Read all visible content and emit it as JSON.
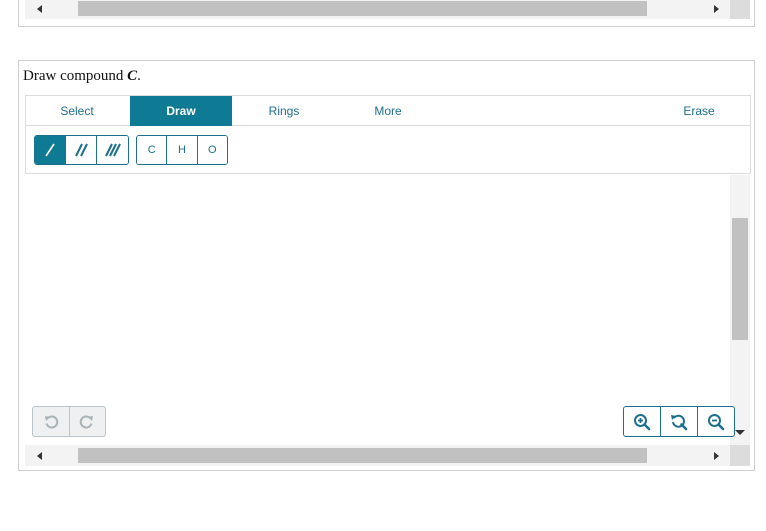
{
  "prompt": {
    "text_before": "Draw compound ",
    "compound": "C",
    "text_after": "."
  },
  "tabs": [
    {
      "label": "Select",
      "active": false
    },
    {
      "label": "Draw",
      "active": true
    },
    {
      "label": "Rings",
      "active": false
    },
    {
      "label": "More",
      "active": false
    },
    {
      "label": "Erase",
      "active": false
    }
  ],
  "bond_tools": [
    {
      "icon": "single-bond-icon",
      "active": true
    },
    {
      "icon": "double-bond-icon",
      "active": false
    },
    {
      "icon": "triple-bond-icon",
      "active": false
    }
  ],
  "atom_tools": [
    "C",
    "H",
    "O"
  ],
  "history_tools": [
    "undo-icon",
    "redo-icon"
  ],
  "zoom_tools": [
    "zoom-in-icon",
    "zoom-reset-icon",
    "zoom-out-icon"
  ],
  "colors": {
    "accent": "#0e7a94",
    "accent_text": "#1d6f8e",
    "border": "#cfcfcf",
    "scroll_track": "#f3f3f3",
    "scroll_thumb": "#c1c1c1"
  }
}
